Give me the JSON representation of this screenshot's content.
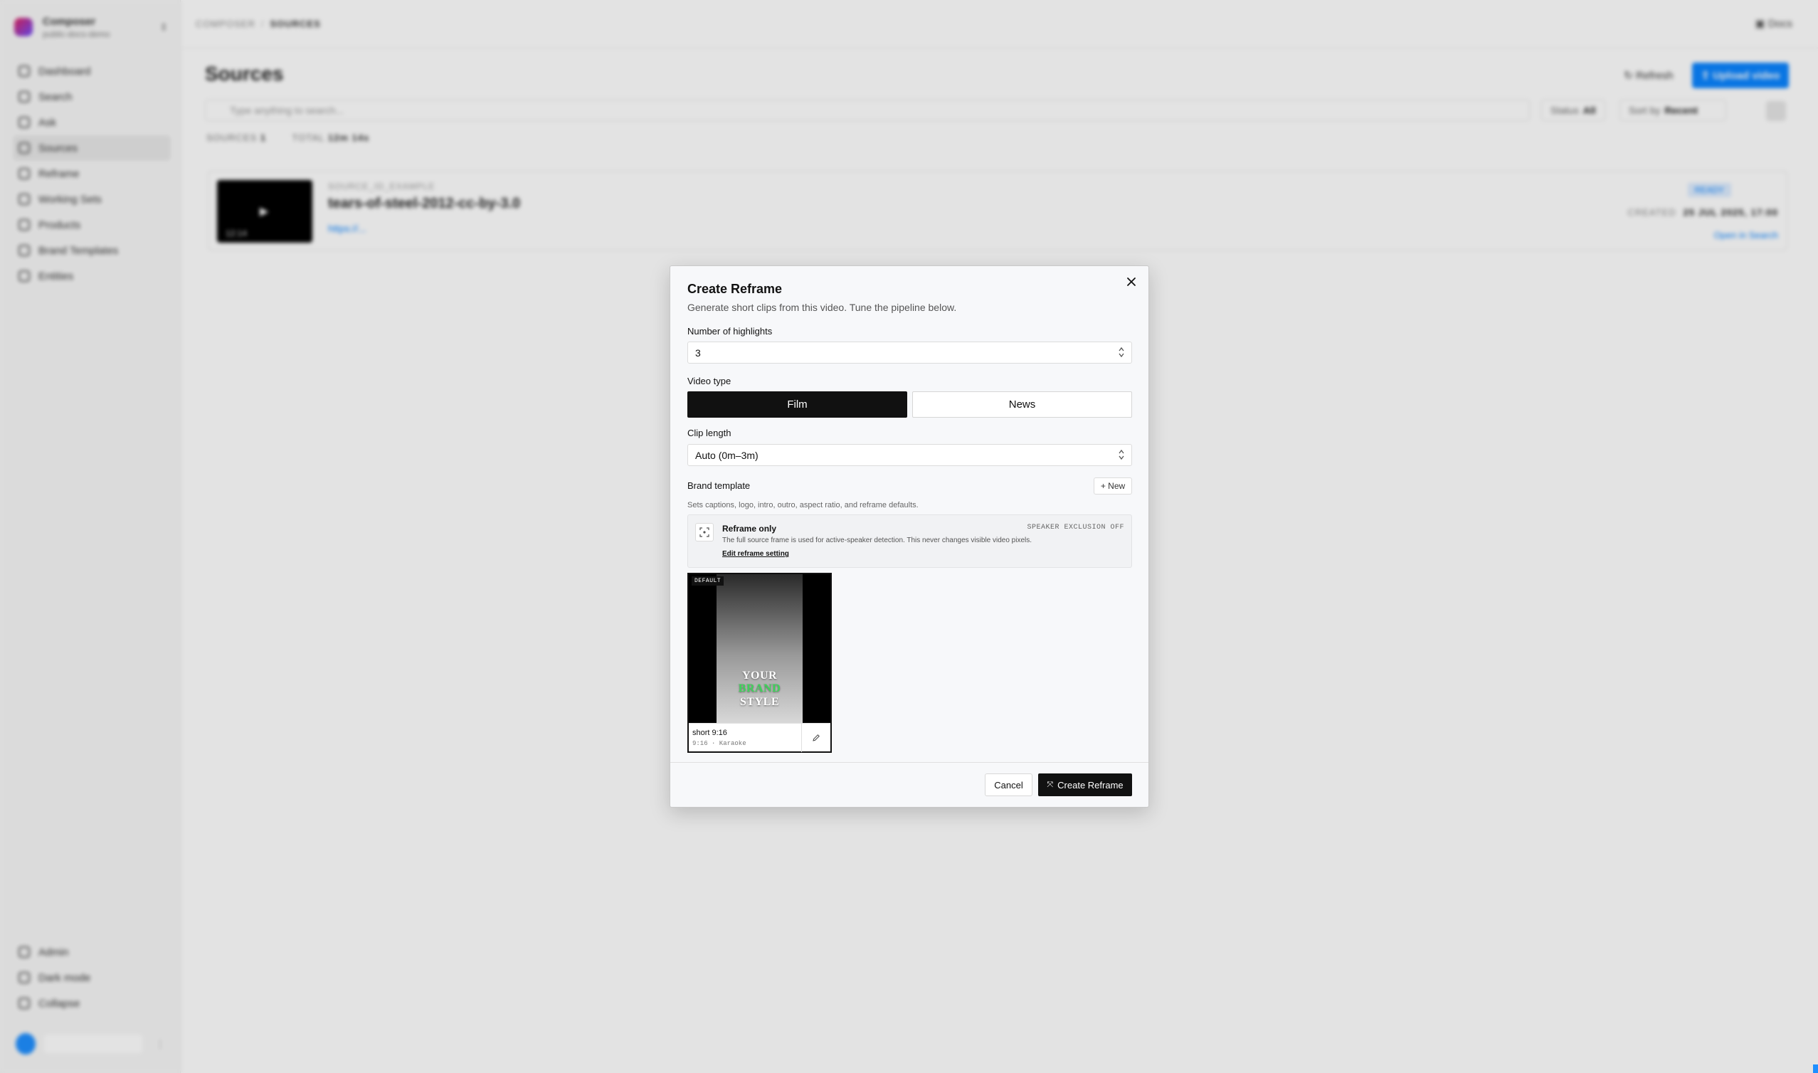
{
  "app": {
    "workspace": {
      "name": "Composer",
      "subtitle": "public-docs-demo"
    },
    "breadcrumb": [
      "COMPOSER",
      "SOURCES"
    ],
    "docs_label": "Docs",
    "nav": [
      "Dashboard",
      "Search",
      "Ask",
      "Sources",
      "Reframe",
      "Working Sets",
      "Products",
      "Brand Templates",
      "Entities"
    ],
    "nav_active": "Sources",
    "nav_bottom": [
      "Admin",
      "Dark mode",
      "Collapse"
    ],
    "page_title": "Sources",
    "refresh_label": "Refresh",
    "upload_label": "Upload video",
    "search_placeholder": "Type anything to search...",
    "status_filter": {
      "label": "Status",
      "value": "All"
    },
    "sort_filter": {
      "label": "Sort by",
      "value": "Recent"
    },
    "stats": {
      "sources_label": "SOURCES",
      "sources_value": "1",
      "total_label": "TOTAL",
      "total_value": "12m 14s"
    },
    "source": {
      "duration": "12:14",
      "id": "SOURCE_ID_EXAMPLE",
      "title": "tears-of-steel-2012-cc-by-3.0",
      "link": "https://...",
      "badge": "READY",
      "created_label": "CREATED",
      "created_value": "25 JUL 2025, 17:00",
      "open_label": "Open in Search"
    }
  },
  "modal": {
    "title": "Create Reframe",
    "subtitle": "Generate short clips from this video. Tune the pipeline below.",
    "highlights_label": "Number of highlights",
    "highlights_value": "3",
    "video_type_label": "Video type",
    "video_type_options": [
      "Film",
      "News"
    ],
    "video_type_selected": "Film",
    "clip_length_label": "Clip length",
    "clip_length_value": "Auto (0m–3m)",
    "brand_template_label": "Brand template",
    "new_label": "New",
    "brand_template_desc": "Sets captions, logo, intro, outro, aspect ratio, and reframe defaults.",
    "reframe": {
      "title": "Reframe only",
      "desc": "The full source frame is used for active-speaker detection. This never changes visible video pixels.",
      "edit_label": "Edit reframe setting",
      "tag": "SPEAKER EXCLUSION OFF"
    },
    "template": {
      "badge": "DEFAULT",
      "preview_lines": [
        "YOUR",
        "BRAND",
        "STYLE"
      ],
      "name": "short 9:16",
      "meta": "9:16 · Karaoke"
    },
    "cancel_label": "Cancel",
    "create_label": "Create Reframe",
    "colors": {
      "primary": "#111111",
      "accent_green": "#3fd35a",
      "upload_blue": "#0a84ff"
    }
  }
}
